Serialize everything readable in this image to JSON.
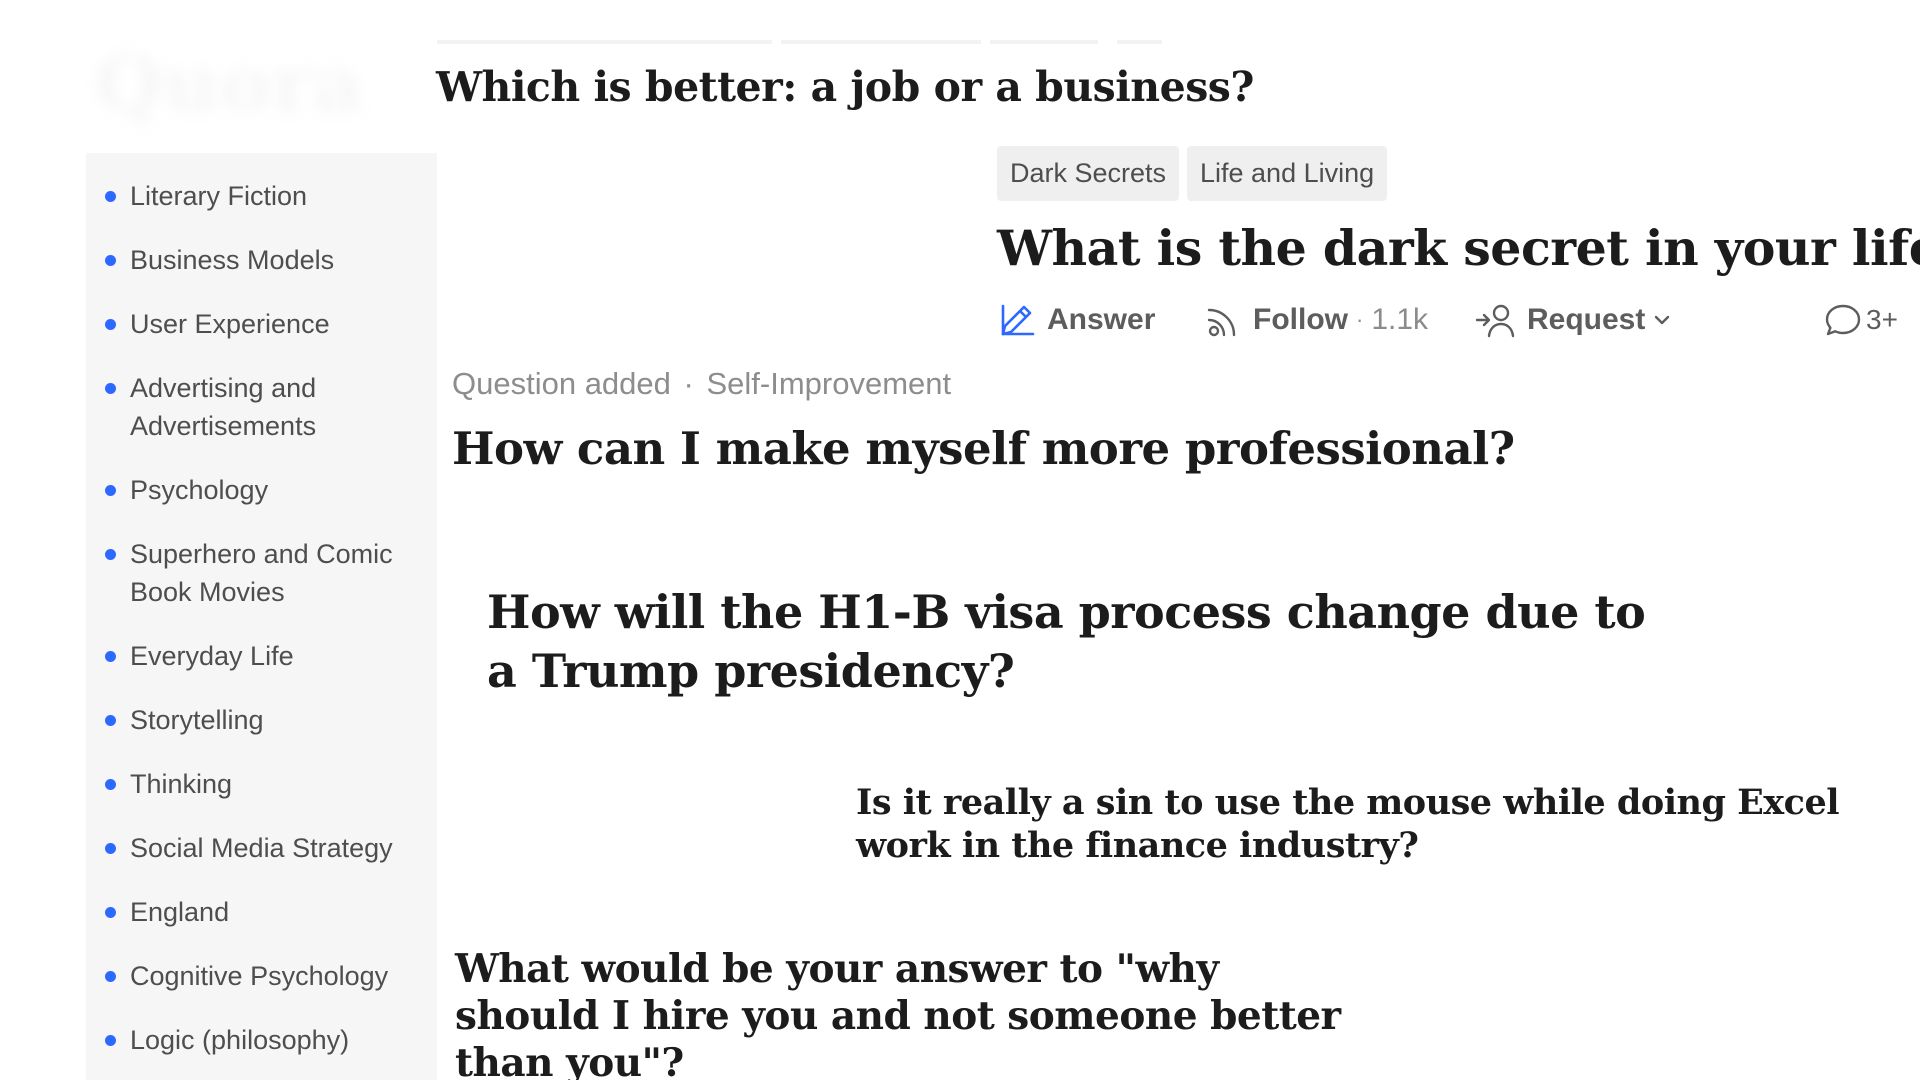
{
  "logo": {
    "text": "Quora"
  },
  "sidebar": {
    "items": [
      {
        "label": "Literary Fiction"
      },
      {
        "label": "Business Models"
      },
      {
        "label": "User Experience"
      },
      {
        "label": "Advertising and Advertisements"
      },
      {
        "label": "Psychology"
      },
      {
        "label": "Superhero and Comic Book Movies"
      },
      {
        "label": "Everyday Life"
      },
      {
        "label": "Storytelling"
      },
      {
        "label": "Thinking"
      },
      {
        "label": "Social Media Strategy"
      },
      {
        "label": "England"
      },
      {
        "label": "Cognitive Psychology"
      },
      {
        "label": "Logic (philosophy)"
      }
    ]
  },
  "questions": {
    "q1": "Which is better: a job or a business?",
    "q2": "What is the dark secret in your life?",
    "q3": "How can I make myself more professional?",
    "q4": "How will the H1-B visa process change due to a Trump presidency?",
    "q5": "Is it really a sin to use the mouse while doing Excel work in the finance industry?",
    "q6": "What would be your answer to \"why should I hire you and not someone better than you\"?"
  },
  "tags": [
    "Dark Secrets",
    "Life and Living"
  ],
  "actions": {
    "answer": "Answer",
    "follow": "Follow",
    "follow_sep": "·",
    "follow_count": "1.1k",
    "request": "Request",
    "comments": "3+"
  },
  "meta": {
    "added": "Question added",
    "sep": "·",
    "topic": "Self-Improvement"
  },
  "colors": {
    "accent": "#2e69ff",
    "sidebar_bg": "#f6f6f7",
    "tag_bg": "#efefef"
  },
  "icons": [
    "pencil-icon",
    "follow-icon",
    "request-icon",
    "chevron-down-icon",
    "comment-icon"
  ]
}
